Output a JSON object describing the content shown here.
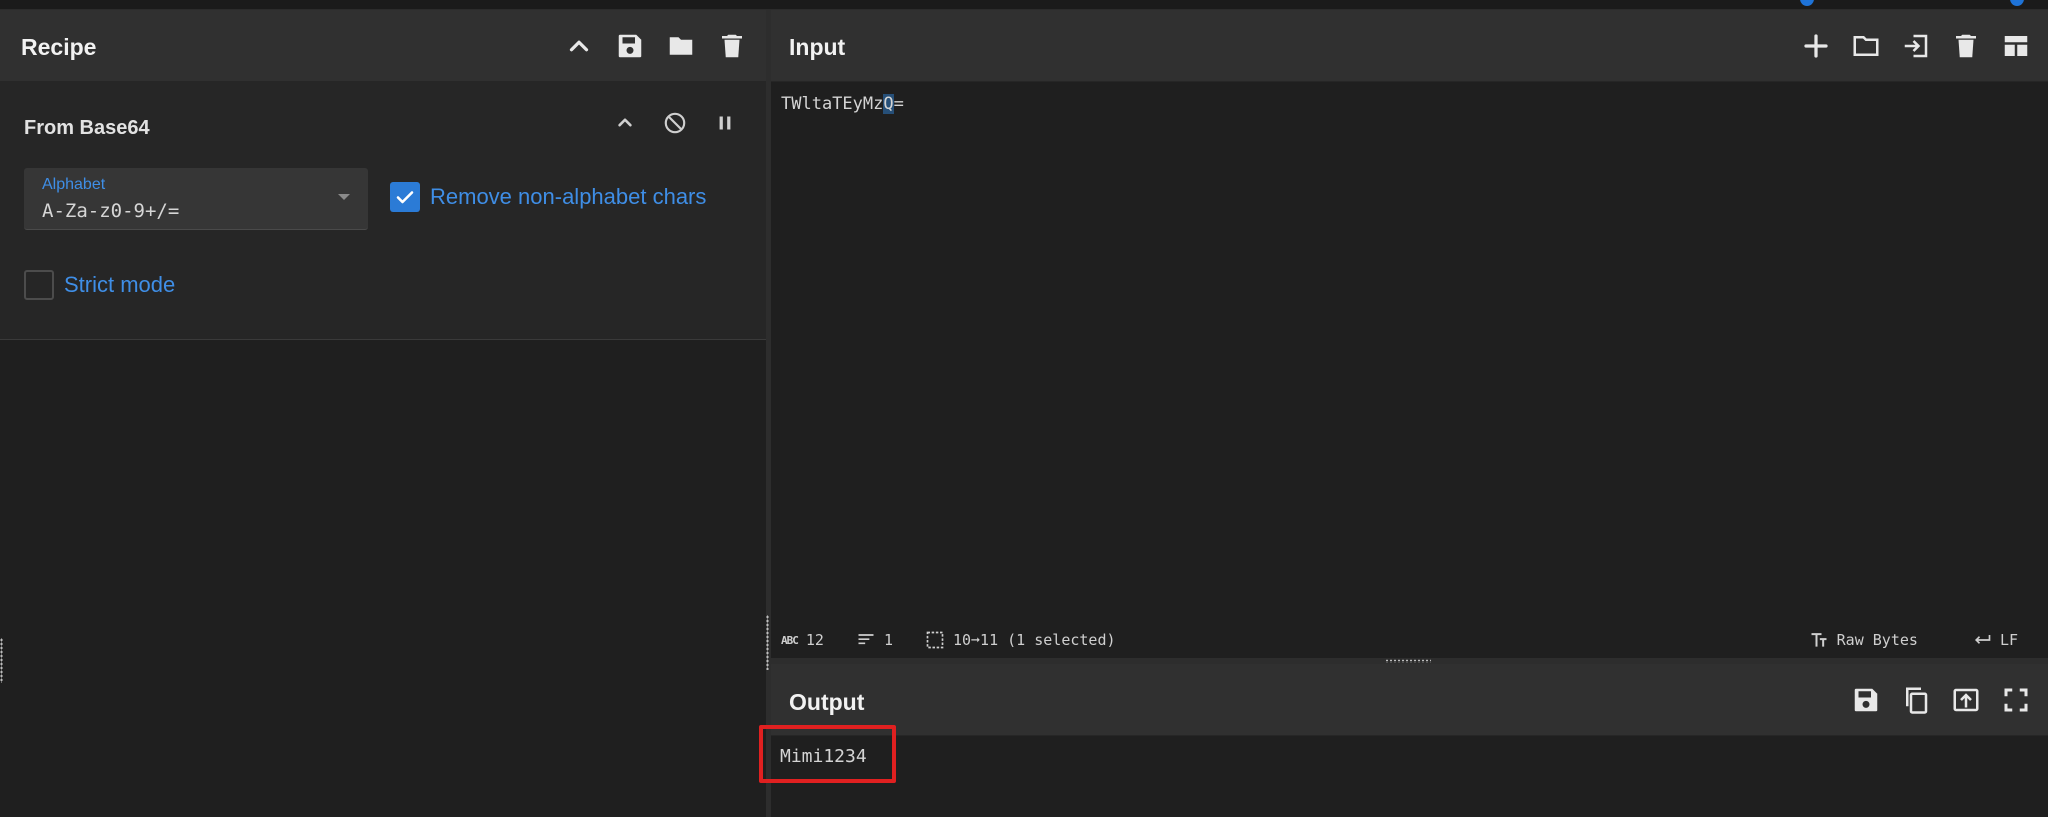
{
  "colors": {
    "accent": "#2b7bd6",
    "accent_text": "#3f8ee6",
    "highlight": "#e02020",
    "panel_header": "#303030",
    "background": "#1f1f1f"
  },
  "recipe": {
    "title": "Recipe",
    "icons": [
      "chevron-up-icon",
      "save-icon",
      "folder-icon",
      "trash-icon"
    ],
    "operation": {
      "title": "From Base64",
      "icons": [
        "chevron-up-icon",
        "disable-icon",
        "pause-icon"
      ],
      "alphabet": {
        "label": "Alphabet",
        "value": "A-Za-z0-9+/="
      },
      "remove_non_alphabet": {
        "label": "Remove non-alphabet chars",
        "checked": true
      },
      "strict_mode": {
        "label": "Strict mode",
        "checked": false
      }
    }
  },
  "input": {
    "title": "Input",
    "icons": [
      "plus-icon",
      "folder-icon",
      "load-icon",
      "trash-icon",
      "layout-icon"
    ],
    "text_before": "TWltaTEyMz",
    "text_selected": "Q",
    "text_after": "=",
    "status": {
      "length": "12",
      "lines": "1",
      "selection": "10➞11 (1 selected)",
      "encoding": "Raw Bytes",
      "eol": "LF"
    }
  },
  "output": {
    "title": "Output",
    "icons": [
      "save-icon",
      "copy-icon",
      "replace-input-icon",
      "fullscreen-icon"
    ],
    "text": "Mimi1234"
  }
}
